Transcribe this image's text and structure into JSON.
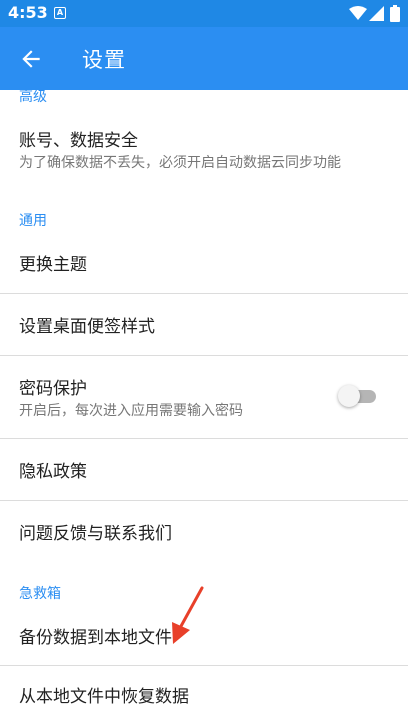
{
  "status": {
    "time": "4:53",
    "notif_icon_text": "A"
  },
  "appbar": {
    "title": "设置"
  },
  "sections": {
    "advanced": "高级",
    "general": "通用",
    "rescue": "急救箱"
  },
  "rows": {
    "account": {
      "title": "账号、数据安全",
      "subtitle": "为了确保数据不丢失，必须开启自动数据云同步功能"
    },
    "theme": {
      "title": "更换主题"
    },
    "widget_style": {
      "title": "设置桌面便签样式"
    },
    "password": {
      "title": "密码保护",
      "subtitle": "开启后，每次进入应用需要输入密码",
      "enabled": false
    },
    "privacy": {
      "title": "隐私政策"
    },
    "feedback": {
      "title": "问题反馈与联系我们"
    },
    "backup": {
      "title": "备份数据到本地文件"
    },
    "restore": {
      "title": "从本地文件中恢复数据"
    }
  },
  "colors": {
    "statusbar": "#1f88e5",
    "appbar": "#2b8ef2",
    "accent": "#2b8ef2",
    "annotation_arrow": "#e8402a"
  }
}
